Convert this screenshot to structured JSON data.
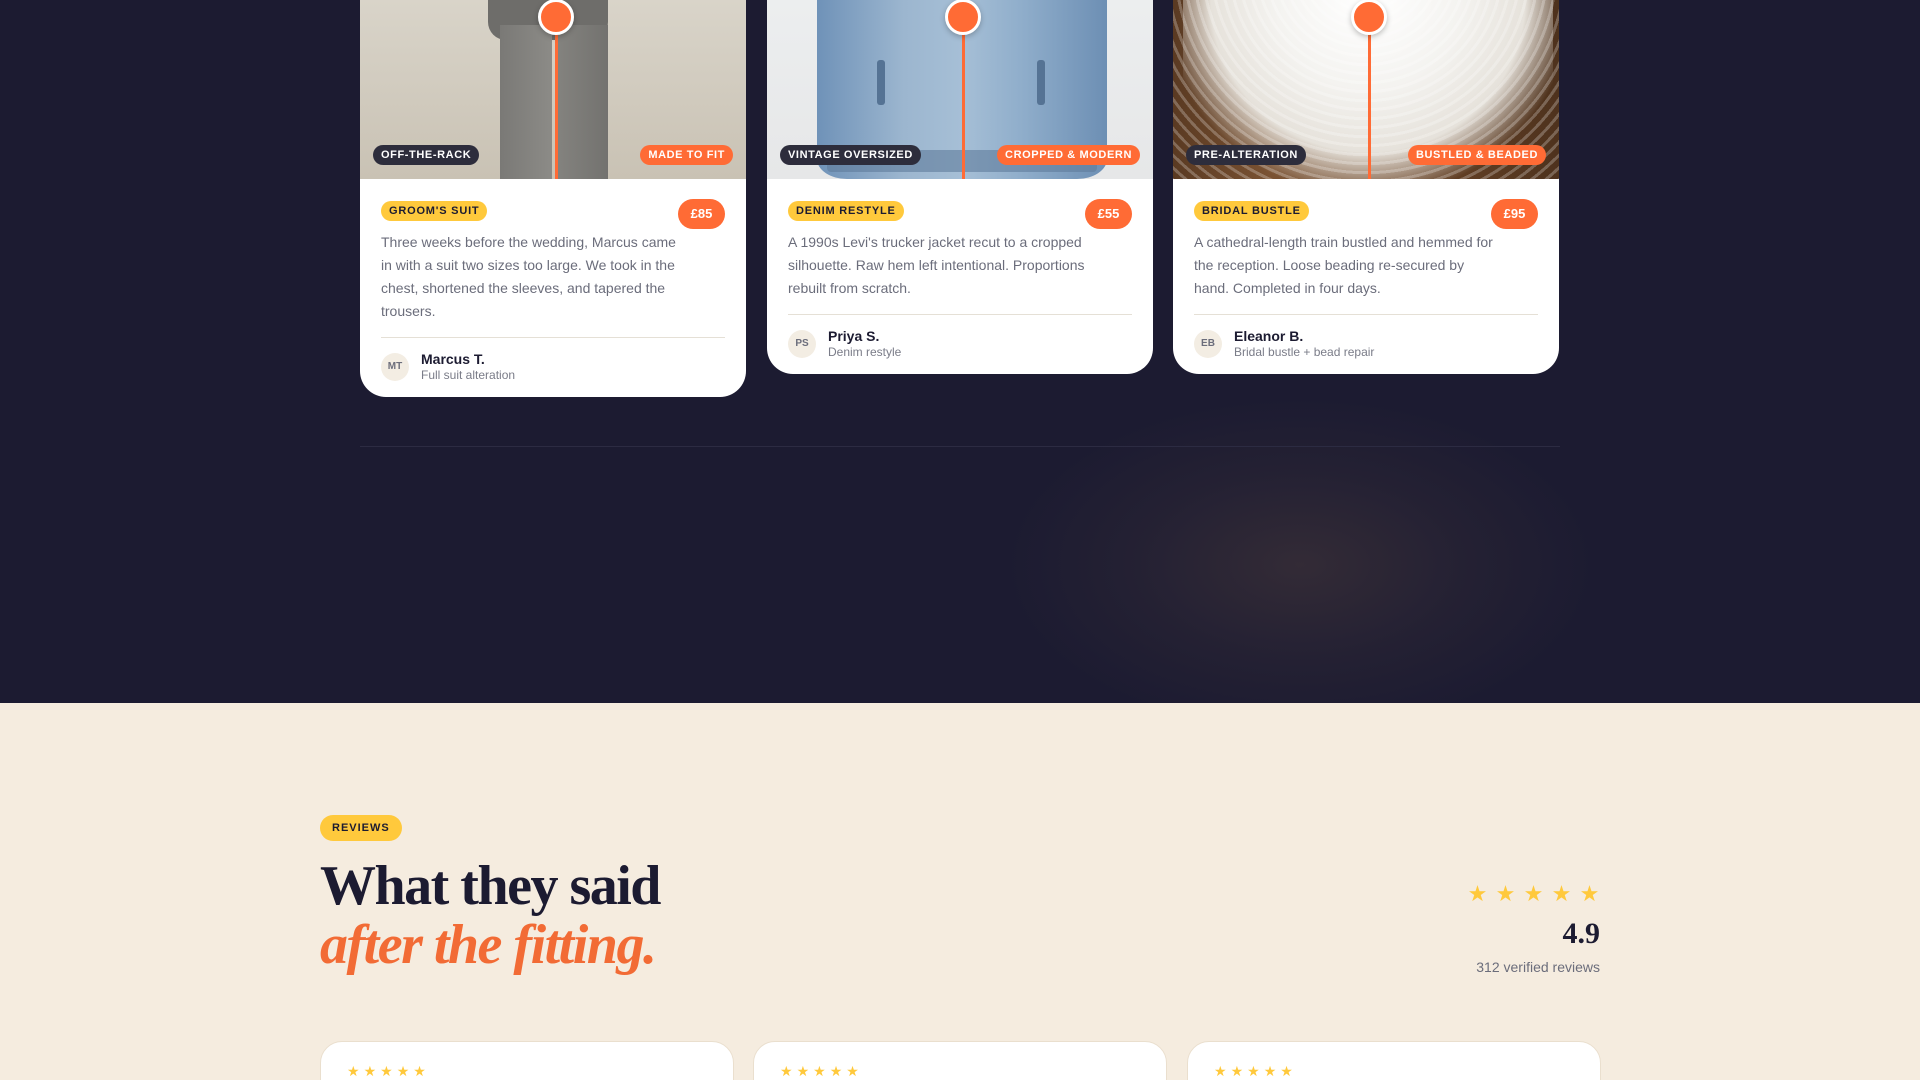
{
  "stories": [
    {
      "before_tag": "OFF-THE-RACK",
      "after_tag": "MADE TO FIT",
      "category": "GROOM'S SUIT",
      "price": "£85",
      "description": "Three weeks before the wedding, Marcus came in with a suit two sizes too large. We took in the chest, shortened the sleeves, and tapered the trousers.",
      "initials": "MT",
      "name": "Marcus T.",
      "service": "Full suit alteration"
    },
    {
      "before_tag": "VINTAGE OVERSIZED",
      "after_tag": "CROPPED & MODERN",
      "category": "DENIM RESTYLE",
      "price": "£55",
      "description": "A 1990s Levi's trucker jacket recut to a cropped silhouette. Raw hem left intentional. Proportions rebuilt from scratch.",
      "initials": "PS",
      "name": "Priya S.",
      "service": "Denim restyle"
    },
    {
      "before_tag": "PRE-ALTERATION",
      "after_tag": "BUSTLED & BEADED",
      "category": "BRIDAL BUSTLE",
      "price": "£95",
      "description": "A cathedral-length train bustled and hemmed for the reception. Loose beading re-secured by hand. Completed in four days.",
      "initials": "EB",
      "name": "Eleanor B.",
      "service": "Bridal bustle + bead repair"
    }
  ],
  "reviews": {
    "badge": "REVIEWS",
    "heading_line1": "What they said",
    "heading_line2": "after the fitting.",
    "rating": "4.9",
    "rating_stars": 5,
    "review_count": "312 verified reviews",
    "cards": [
      {
        "stars": 5
      },
      {
        "stars": 5
      },
      {
        "stars": 5
      }
    ]
  },
  "colors": {
    "navy": "#1c1b31",
    "accent_orange": "#ff6b35",
    "accent_yellow": "#ffc93c",
    "cream": "#f5ecdf"
  },
  "icons": {
    "star": "star-icon",
    "slider_handle": "slider-handle-icon"
  }
}
